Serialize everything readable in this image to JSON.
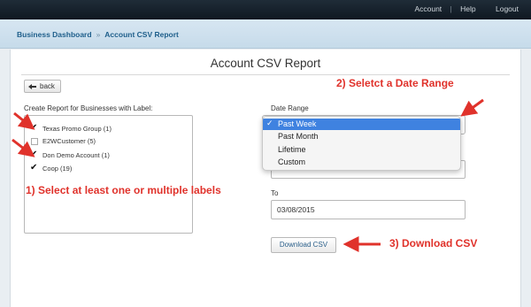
{
  "topnav": {
    "account": "Account",
    "separator": "|",
    "help": "Help",
    "logout": "Logout"
  },
  "breadcrumb": {
    "parent": "Business Dashboard",
    "arrow": "»",
    "current": "Account CSV Report"
  },
  "page": {
    "title": "Account CSV Report",
    "back_label": "back"
  },
  "labels_section": {
    "heading": "Create Report for Businesses with Label:",
    "items": [
      {
        "label": "Texas Promo Group (1)",
        "checked": true
      },
      {
        "label": "E2WCustomer (5)",
        "checked": false
      },
      {
        "label": "Don Demo Account (1)",
        "checked": true
      },
      {
        "label": "Coop (19)",
        "checked": true
      }
    ]
  },
  "date_range": {
    "heading": "Date Range",
    "options": [
      "Past Week",
      "Past Month",
      "Lifetime",
      "Custom"
    ],
    "selected": "Past Week",
    "check_glyph": "✓"
  },
  "to_field": {
    "label": "To",
    "value": "03/08/2015"
  },
  "download_label": "Download CSV",
  "annotations": {
    "step1": "1) Select at least one or multiple labels",
    "step2": "2) Seletct a Date Range",
    "step3": "3) Download CSV",
    "color": "#e0322b"
  },
  "colors": {
    "topbar": "#1f2c38",
    "crumbbar": "#cfe0ee",
    "selected_option": "#3f82e0"
  }
}
